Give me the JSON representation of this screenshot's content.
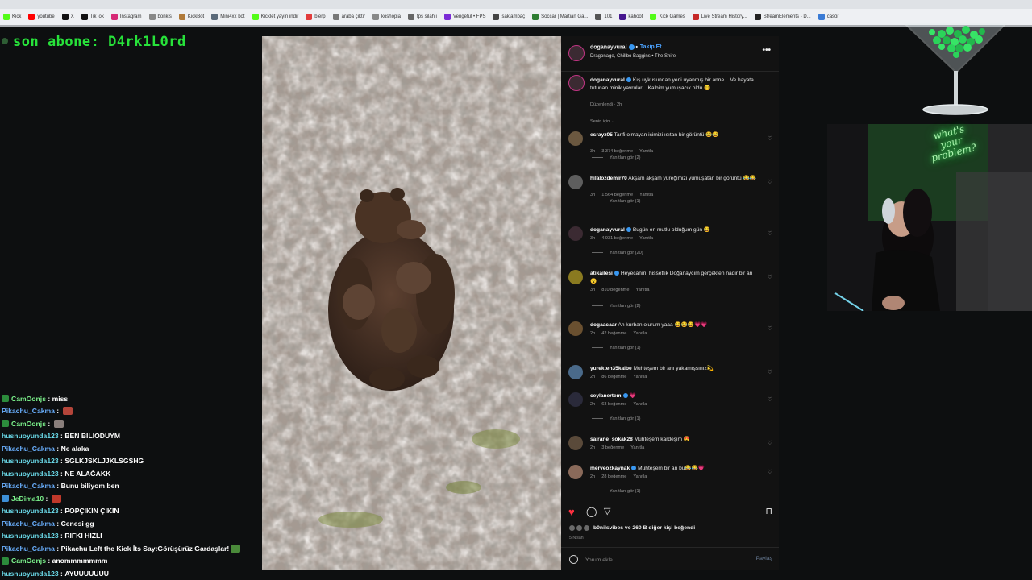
{
  "bookmarks": [
    {
      "label": "Kick",
      "color": "#53fc18"
    },
    {
      "label": "youtube",
      "color": "#ff0000"
    },
    {
      "label": "X",
      "color": "#111111"
    },
    {
      "label": "TikTok",
      "color": "#111111"
    },
    {
      "label": "Instagram",
      "color": "#d62976"
    },
    {
      "label": "bonkis",
      "color": "#888888"
    },
    {
      "label": "KickBot",
      "color": "#b07a3a"
    },
    {
      "label": "Mini4xx bot",
      "color": "#5a6a7a"
    },
    {
      "label": "Kicklet yayın indir",
      "color": "#53fc18"
    },
    {
      "label": "blerp",
      "color": "#e23b3b"
    },
    {
      "label": "araba çiktir",
      "color": "#777777"
    },
    {
      "label": "koshopia",
      "color": "#888888"
    },
    {
      "label": "fps silahlı",
      "color": "#666666"
    },
    {
      "label": "Vengeful • FPS",
      "color": "#7b2bd6"
    },
    {
      "label": "saklambaç",
      "color": "#444444"
    },
    {
      "label": "Soccar | Martian Ga...",
      "color": "#2e7d32"
    },
    {
      "label": "101",
      "color": "#555555"
    },
    {
      "label": "kahoot",
      "color": "#46178f"
    },
    {
      "label": "Kick Games",
      "color": "#53fc18"
    },
    {
      "label": "Live Stream History...",
      "color": "#c62828"
    },
    {
      "label": "StreamElements - D...",
      "color": "#222222"
    },
    {
      "label": "casör",
      "color": "#3a7bd5"
    }
  ],
  "overlay": {
    "sub_banner": "son abone: D4rk1L0rd"
  },
  "chat": [
    {
      "user": "CamOonjs",
      "user_color": "#7cf28c",
      "badge": "#2c8c3c",
      "message": "miss",
      "emote": ""
    },
    {
      "user": "Pikachu_Cakma",
      "user_color": "#6ab0ff",
      "badge": "",
      "message": "",
      "emote": "#b4453a"
    },
    {
      "user": "CamOonjs",
      "user_color": "#7cf28c",
      "badge": "#2c8c3c",
      "message": "",
      "emote": "#8a7f7c"
    },
    {
      "user": "husnuoyunda123",
      "user_color": "#6ad9e8",
      "badge": "",
      "message": "BEN BİLİODUYM",
      "emote": ""
    },
    {
      "user": "Pikachu_Cakma",
      "user_color": "#6ab0ff",
      "badge": "",
      "message": "Ne alaka",
      "emote": ""
    },
    {
      "user": "husnuoyunda123",
      "user_color": "#6ad9e8",
      "badge": "",
      "message": "SGLKJSKLJJKLSGSHG",
      "emote": ""
    },
    {
      "user": "husnuoyunda123",
      "user_color": "#6ad9e8",
      "badge": "",
      "message": "NE ALAĞAKK",
      "emote": ""
    },
    {
      "user": "Pikachu_Cakma",
      "user_color": "#6ab0ff",
      "badge": "",
      "message": "Bunu biliyom ben",
      "emote": ""
    },
    {
      "user": "JeDima10",
      "user_color": "#7cf28c",
      "badge": "#3d8fd6",
      "message": "",
      "emote": "#c0392b"
    },
    {
      "user": "husnuoyunda123",
      "user_color": "#6ad9e8",
      "badge": "",
      "message": "POPÇIKIN ÇIKIN",
      "emote": ""
    },
    {
      "user": "Pikachu_Cakma",
      "user_color": "#6ab0ff",
      "badge": "",
      "message": "Cenesi gg",
      "emote": ""
    },
    {
      "user": "husnuoyunda123",
      "user_color": "#6ad9e8",
      "badge": "",
      "message": "RIFKI HIZLI",
      "emote": ""
    },
    {
      "user": "Pikachu_Cakma",
      "user_color": "#6ab0ff",
      "badge": "",
      "message": "Pikachu Left the Kick İts Say:Görüşürüz Gardaşlar!",
      "emote": "#4a8a3a"
    },
    {
      "user": "CamOonjs",
      "user_color": "#7cf28c",
      "badge": "#2c8c3c",
      "message": "anommmmmmm",
      "emote": ""
    },
    {
      "user": "husnuoyunda123",
      "user_color": "#6ad9e8",
      "badge": "",
      "message": "AYUUUUUUU",
      "emote": ""
    }
  ],
  "post": {
    "username": "doganayvural",
    "follow_label": "Takip Et",
    "audio": "Dragonage, Chillbo Baggins • The Shire",
    "more_icon": "more-horizontal-icon",
    "caption_user": "doganayvural",
    "caption": "Kış uykusundan yeni uyanmış bir anne... Ve hayata tutunan minik yavrular... Kalbim yumuşacık oldu 😊",
    "caption_meta": "Düzenlendi · 2h",
    "for_you_label": "Senin için",
    "comments": [
      {
        "user": "esrayz05",
        "verified": false,
        "text": "Tarifi olmayan içimizi ısıtan bir görüntü 😂😂",
        "time": "3h",
        "likes": "3.374 beğenme",
        "reply": "Yanıtla",
        "replies": "Yanıtları gör (2)",
        "avatar": "#6b5840"
      },
      {
        "user": "hilalozdemir70",
        "verified": false,
        "text": "Akşam akşam yüreğimizi yumuşatan bir görüntü 😂😂",
        "time": "3h",
        "likes": "1.564 beğenme",
        "reply": "Yanıtla",
        "replies": "Yanıtları gör (1)",
        "avatar": "#5e5e5e"
      },
      {
        "user": "doganayvural",
        "verified": true,
        "text": "Bugün en mutlu olduğum gün 😂",
        "time": "3h",
        "likes": "4.931 beğenme",
        "reply": "Yanıtla",
        "replies": "Yanıtları gör (20)",
        "avatar": "#3b2a32"
      },
      {
        "user": "atikailesi",
        "verified": true,
        "text": "Heyecanını hissettik Doğanaycım gerçekten nadir bir an 😮",
        "time": "3h",
        "likes": "810 beğenme",
        "reply": "Yanıtla",
        "replies": "Yanıtları gör (2)",
        "avatar": "#8a7a20"
      },
      {
        "user": "dogaacaar",
        "verified": false,
        "text": "Ah kurban olurum yaaa 😂😂😂💗💗",
        "time": "2h",
        "likes": "42 beğenme",
        "reply": "Yanıtla",
        "replies": "Yanıtları gör (1)",
        "avatar": "#6a5030"
      },
      {
        "user": "yurekten35kalbe",
        "verified": false,
        "text": "Muhteşem bir anı yakamışsınız💫",
        "time": "2h",
        "likes": "86 beğenme",
        "reply": "Yanıtla",
        "replies": "",
        "avatar": "#4a6a8a"
      },
      {
        "user": "ceylanertem",
        "verified": true,
        "text": "💗",
        "time": "2h",
        "likes": "63 beğenme",
        "reply": "Yanıtla",
        "replies": "Yanıtları gör (1)",
        "avatar": "#2a2a3a"
      },
      {
        "user": "sairane_sokak28",
        "verified": false,
        "text": "Muhteşem kardeşim 😍",
        "time": "2h",
        "likes": "3 beğenme",
        "reply": "Yanıtla",
        "replies": "",
        "avatar": "#5a4a3a"
      },
      {
        "user": "merveozkaynak",
        "verified": true,
        "text": "Muhteşem bir an bu😂😂💗",
        "time": "2h",
        "likes": "28 beğenme",
        "reply": "Yanıtla",
        "replies": "Yanıtları gör (1)",
        "avatar": "#8a6a5a"
      }
    ],
    "likes_text": "b0nilsvibes ve 260 B diğer kişi beğendi",
    "date": "5 Nisan",
    "comment_placeholder": "Yorum ekle...",
    "post_label": "Paylaş"
  },
  "webcam": {
    "neon_line1": "what's",
    "neon_line2": "your",
    "neon_line3": "problem?"
  },
  "colors": {
    "accent_green": "#27e23a",
    "ig_blue": "#3897f0",
    "like_red": "#ff3040"
  }
}
